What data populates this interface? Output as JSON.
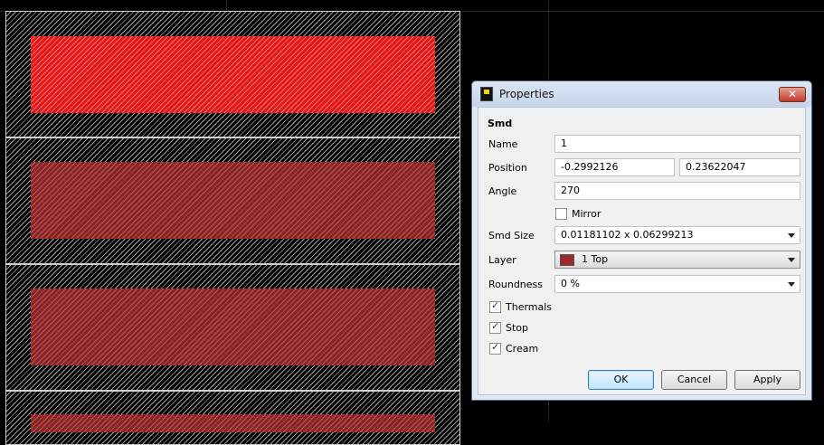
{
  "dialog": {
    "title": "Properties",
    "close_label": "✕",
    "section": "Smd",
    "fields": {
      "name": {
        "label": "Name",
        "value": "1"
      },
      "position": {
        "label": "Position",
        "x": "-0.2992126",
        "y": "0.23622047"
      },
      "angle": {
        "label": "Angle",
        "value": "270"
      },
      "mirror": {
        "label": "Mirror",
        "checked": false
      },
      "smd_size": {
        "label": "Smd Size",
        "value": "0.01181102 x 0.06299213"
      },
      "layer": {
        "label": "Layer",
        "value": "1 Top",
        "color": "#9a2a2a"
      },
      "roundness": {
        "label": "Roundness",
        "value": "0 %"
      },
      "thermals": {
        "label": "Thermals",
        "checked": true
      },
      "stop": {
        "label": "Stop",
        "checked": true
      },
      "cream": {
        "label": "Cream",
        "checked": true
      }
    },
    "buttons": {
      "ok": "OK",
      "cancel": "Cancel",
      "apply": "Apply"
    }
  },
  "canvas": {
    "selected_pad_color": "#e21818",
    "pad_color": "#8a2424",
    "background": "#000000"
  }
}
